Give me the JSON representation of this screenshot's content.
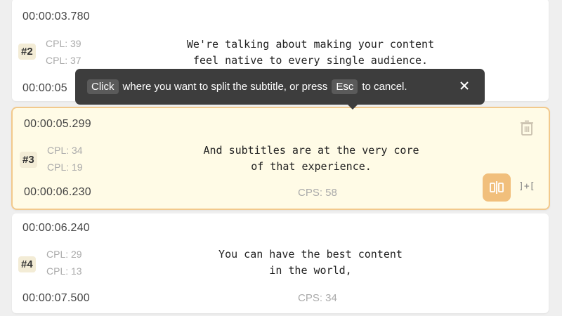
{
  "accent": "#f1bf7c",
  "highlight_bg": "#fffbe6",
  "tooltip": {
    "key_click": "Click",
    "text_1": "where you want to split the subtitle, or press",
    "key_esc": "Esc",
    "text_2": "to cancel.",
    "close_icon": "close-icon"
  },
  "subtitles": [
    {
      "index": "#2",
      "start": "00:00:03.780",
      "end": "00:00:05",
      "cpl_1": "CPL: 39",
      "cpl_2": "CPL: 37",
      "line_1": "We're talking about making your content",
      "line_2": "feel native to every single audience."
    },
    {
      "index": "#3",
      "start": "00:00:05.299",
      "end": "00:00:06.230",
      "cpl_1": "CPL: 34",
      "cpl_2": "CPL: 19",
      "line_1": "And subtitles are at the very core",
      "line_2": "of that experience.",
      "cps": "CPS: 58",
      "merge_label": "]+["
    },
    {
      "index": "#4",
      "start": "00:00:06.240",
      "end": "00:00:07.500",
      "cpl_1": "CPL: 29",
      "cpl_2": "CPL: 13",
      "line_1": "You can have the best content",
      "line_2": "in the world,",
      "cps": "CPS: 34"
    }
  ]
}
